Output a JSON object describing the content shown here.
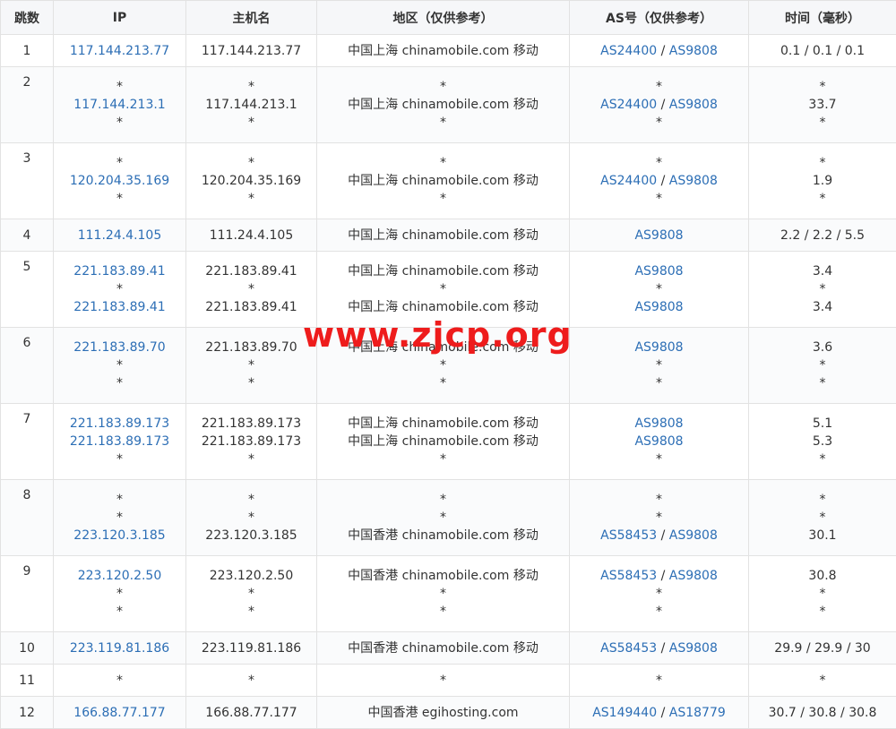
{
  "headers": [
    "跳数",
    "IP",
    "主机名",
    "地区（仅供参考）",
    "AS号（仅供参考）",
    "时间（毫秒）"
  ],
  "watermark": "www.zjcp.org",
  "rows": [
    {
      "hop": "1",
      "lines": [
        {
          "ip": "117.144.213.77",
          "host": "117.144.213.77",
          "region": "中国上海 chinamobile.com 移动",
          "as": [
            "AS24400",
            "AS9808"
          ],
          "time": "0.1 / 0.1 / 0.1"
        }
      ]
    },
    {
      "hop": "2",
      "lines": [
        {
          "ip": "*",
          "host": "*",
          "region": "*",
          "as": [
            "*"
          ],
          "time": "*"
        },
        {
          "ip": "117.144.213.1",
          "host": "117.144.213.1",
          "region": "中国上海 chinamobile.com 移动",
          "as": [
            "AS24400",
            "AS9808"
          ],
          "time": "33.7"
        },
        {
          "ip": "*",
          "host": "*",
          "region": "*",
          "as": [
            "*"
          ],
          "time": "*"
        }
      ]
    },
    {
      "hop": "3",
      "lines": [
        {
          "ip": "*",
          "host": "*",
          "region": "*",
          "as": [
            "*"
          ],
          "time": "*"
        },
        {
          "ip": "120.204.35.169",
          "host": "120.204.35.169",
          "region": "中国上海 chinamobile.com 移动",
          "as": [
            "AS24400",
            "AS9808"
          ],
          "time": "1.9"
        },
        {
          "ip": "*",
          "host": "*",
          "region": "*",
          "as": [
            "*"
          ],
          "time": "*"
        }
      ]
    },
    {
      "hop": "4",
      "lines": [
        {
          "ip": "111.24.4.105",
          "host": "111.24.4.105",
          "region": "中国上海 chinamobile.com 移动",
          "as": [
            "AS9808"
          ],
          "time": "2.2 / 2.2 / 5.5"
        }
      ]
    },
    {
      "hop": "5",
      "lines": [
        {
          "ip": "221.183.89.41",
          "host": "221.183.89.41",
          "region": "中国上海 chinamobile.com 移动",
          "as": [
            "AS9808"
          ],
          "time": "3.4"
        },
        {
          "ip": "*",
          "host": "*",
          "region": "*",
          "as": [
            "*"
          ],
          "time": "*"
        },
        {
          "ip": "221.183.89.41",
          "host": "221.183.89.41",
          "region": "中国上海 chinamobile.com 移动",
          "as": [
            "AS9808"
          ],
          "time": "3.4"
        }
      ]
    },
    {
      "hop": "6",
      "lines": [
        {
          "ip": "221.183.89.70",
          "host": "221.183.89.70",
          "region": "中国上海 chinamobile.com 移动",
          "as": [
            "AS9808"
          ],
          "time": "3.6"
        },
        {
          "ip": "*",
          "host": "*",
          "region": "*",
          "as": [
            "*"
          ],
          "time": "*"
        },
        {
          "ip": "*",
          "host": "*",
          "region": "*",
          "as": [
            "*"
          ],
          "time": "*"
        }
      ]
    },
    {
      "hop": "7",
      "lines": [
        {
          "ip": "221.183.89.173",
          "host": "221.183.89.173",
          "region": "中国上海 chinamobile.com 移动",
          "as": [
            "AS9808"
          ],
          "time": "5.1"
        },
        {
          "ip": "221.183.89.173",
          "host": "221.183.89.173",
          "region": "中国上海 chinamobile.com 移动",
          "as": [
            "AS9808"
          ],
          "time": "5.3"
        },
        {
          "ip": "*",
          "host": "*",
          "region": "*",
          "as": [
            "*"
          ],
          "time": "*"
        }
      ]
    },
    {
      "hop": "8",
      "lines": [
        {
          "ip": "*",
          "host": "*",
          "region": "*",
          "as": [
            "*"
          ],
          "time": "*"
        },
        {
          "ip": "*",
          "host": "*",
          "region": "*",
          "as": [
            "*"
          ],
          "time": "*"
        },
        {
          "ip": "223.120.3.185",
          "host": "223.120.3.185",
          "region": "中国香港 chinamobile.com 移动",
          "as": [
            "AS58453",
            "AS9808"
          ],
          "time": "30.1"
        }
      ]
    },
    {
      "hop": "9",
      "lines": [
        {
          "ip": "223.120.2.50",
          "host": "223.120.2.50",
          "region": "中国香港 chinamobile.com 移动",
          "as": [
            "AS58453",
            "AS9808"
          ],
          "time": "30.8"
        },
        {
          "ip": "*",
          "host": "*",
          "region": "*",
          "as": [
            "*"
          ],
          "time": "*"
        },
        {
          "ip": "*",
          "host": "*",
          "region": "*",
          "as": [
            "*"
          ],
          "time": "*"
        }
      ]
    },
    {
      "hop": "10",
      "lines": [
        {
          "ip": "223.119.81.186",
          "host": "223.119.81.186",
          "region": "中国香港 chinamobile.com 移动",
          "as": [
            "AS58453",
            "AS9808"
          ],
          "time": "29.9 / 29.9 / 30"
        }
      ]
    },
    {
      "hop": "11",
      "lines": [
        {
          "ip": "*",
          "host": "*",
          "region": "*",
          "as": [
            "*"
          ],
          "time": "*"
        }
      ]
    },
    {
      "hop": "12",
      "lines": [
        {
          "ip": "166.88.77.177",
          "host": "166.88.77.177",
          "region": "中国香港 egihosting.com",
          "as": [
            "AS149440",
            "AS18779"
          ],
          "time": "30.7 / 30.8 / 30.8"
        }
      ]
    }
  ]
}
